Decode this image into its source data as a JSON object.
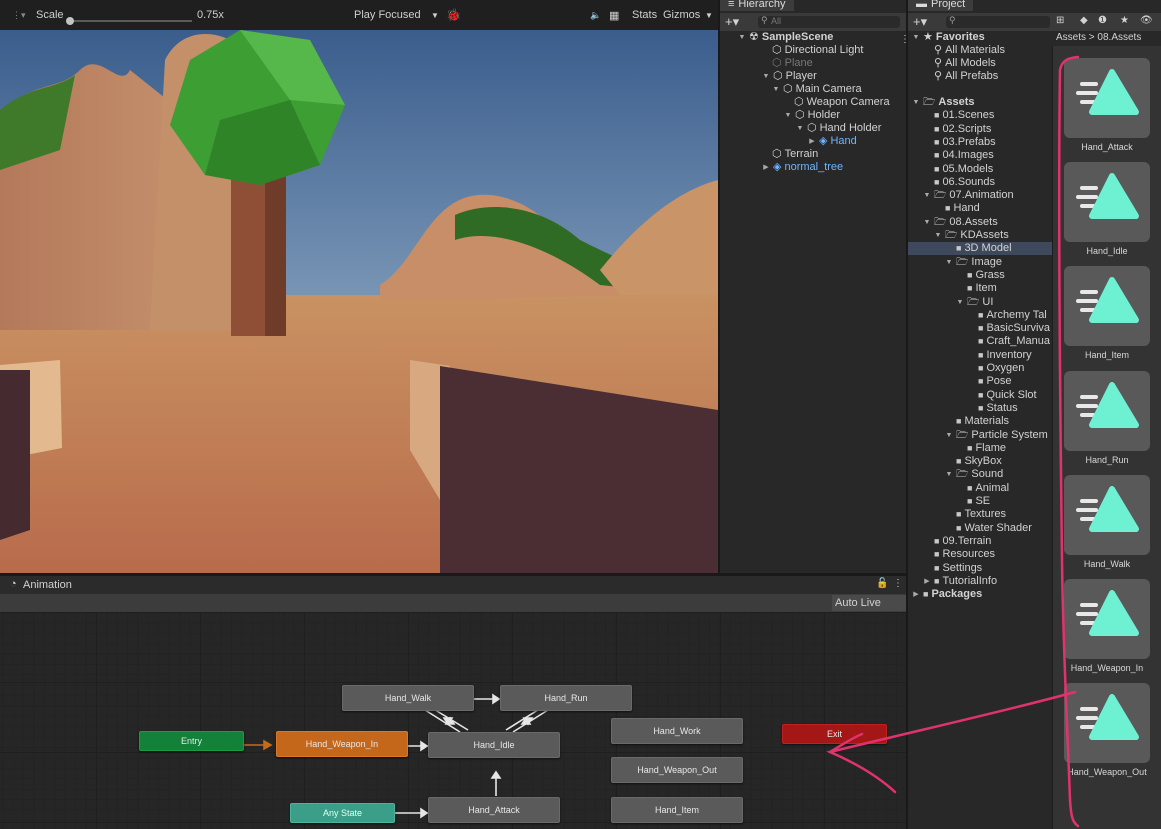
{
  "scene": {
    "toolbar": {
      "scale_label": "Scale",
      "scale_value": "0.75x",
      "play_mode": "Play Focused",
      "stats": "Stats",
      "gizmos": "Gizmos"
    }
  },
  "hierarchy": {
    "tab": "Hierarchy",
    "search_placeholder": "All",
    "items": [
      {
        "label": "SampleScene",
        "icon": "unity-scene-icon"
      },
      {
        "label": "Directional Light",
        "icon": "gameobject-icon"
      },
      {
        "label": "Plane",
        "icon": "gameobject-icon"
      },
      {
        "label": "Player",
        "icon": "gameobject-icon"
      },
      {
        "label": "Main Camera",
        "icon": "gameobject-icon"
      },
      {
        "label": "Weapon Camera",
        "icon": "gameobject-icon"
      },
      {
        "label": "Holder",
        "icon": "gameobject-icon"
      },
      {
        "label": "Hand Holder",
        "icon": "gameobject-icon"
      },
      {
        "label": "Hand",
        "icon": "prefab-icon"
      },
      {
        "label": "Terrain",
        "icon": "gameobject-icon"
      },
      {
        "label": "normal_tree",
        "icon": "prefab-icon"
      }
    ]
  },
  "project": {
    "tab": "Project",
    "breadcrumb": [
      "Assets",
      "08.Assets"
    ],
    "favorites": {
      "label": "Favorites",
      "items": [
        "All Materials",
        "All Models",
        "All Prefabs"
      ]
    },
    "tree": [
      "Assets",
      "01.Scenes",
      "02.Scripts",
      "03.Prefabs",
      "04.Images",
      "05.Models",
      "06.Sounds",
      "07.Animation",
      "Hand",
      "08.Assets",
      "KDAssets",
      "3D Model",
      "Image",
      "Grass",
      "Item",
      "UI",
      "Archemy Tal",
      "BasicSurviva",
      "Craft_Manua",
      "Inventory",
      "Oxygen",
      "Pose",
      "Quick Slot",
      "Status",
      "Materials",
      "Particle System",
      "Flame",
      "SkyBox",
      "Sound",
      "Animal",
      "SE",
      "Textures",
      "Water Shader",
      "09.Terrain",
      "Resources",
      "Settings",
      "TutorialInfo",
      "Packages"
    ],
    "assets": [
      "Hand_Attack",
      "Hand_Idle",
      "Hand_Item",
      "Hand_Run",
      "Hand_Walk",
      "Hand_Weapon_In",
      "Hand_Weapon_Out"
    ]
  },
  "animation": {
    "tab": "Animation",
    "live_link": "Auto Live Link",
    "states": {
      "walk": "Hand_Walk",
      "run": "Hand_Run",
      "work": "Hand_Work",
      "entry": "Entry",
      "weapon_in": "Hand_Weapon_In",
      "idle": "Hand_Idle",
      "exit": "Exit",
      "weapon_out": "Hand_Weapon_Out",
      "any_state": "Any State",
      "attack": "Hand_Attack",
      "item": "Hand_Item"
    }
  },
  "colors": {
    "accent_annotation": "#e0336d",
    "asset_icon": "#6ef0d2",
    "prefab": "#6fb4ff"
  }
}
